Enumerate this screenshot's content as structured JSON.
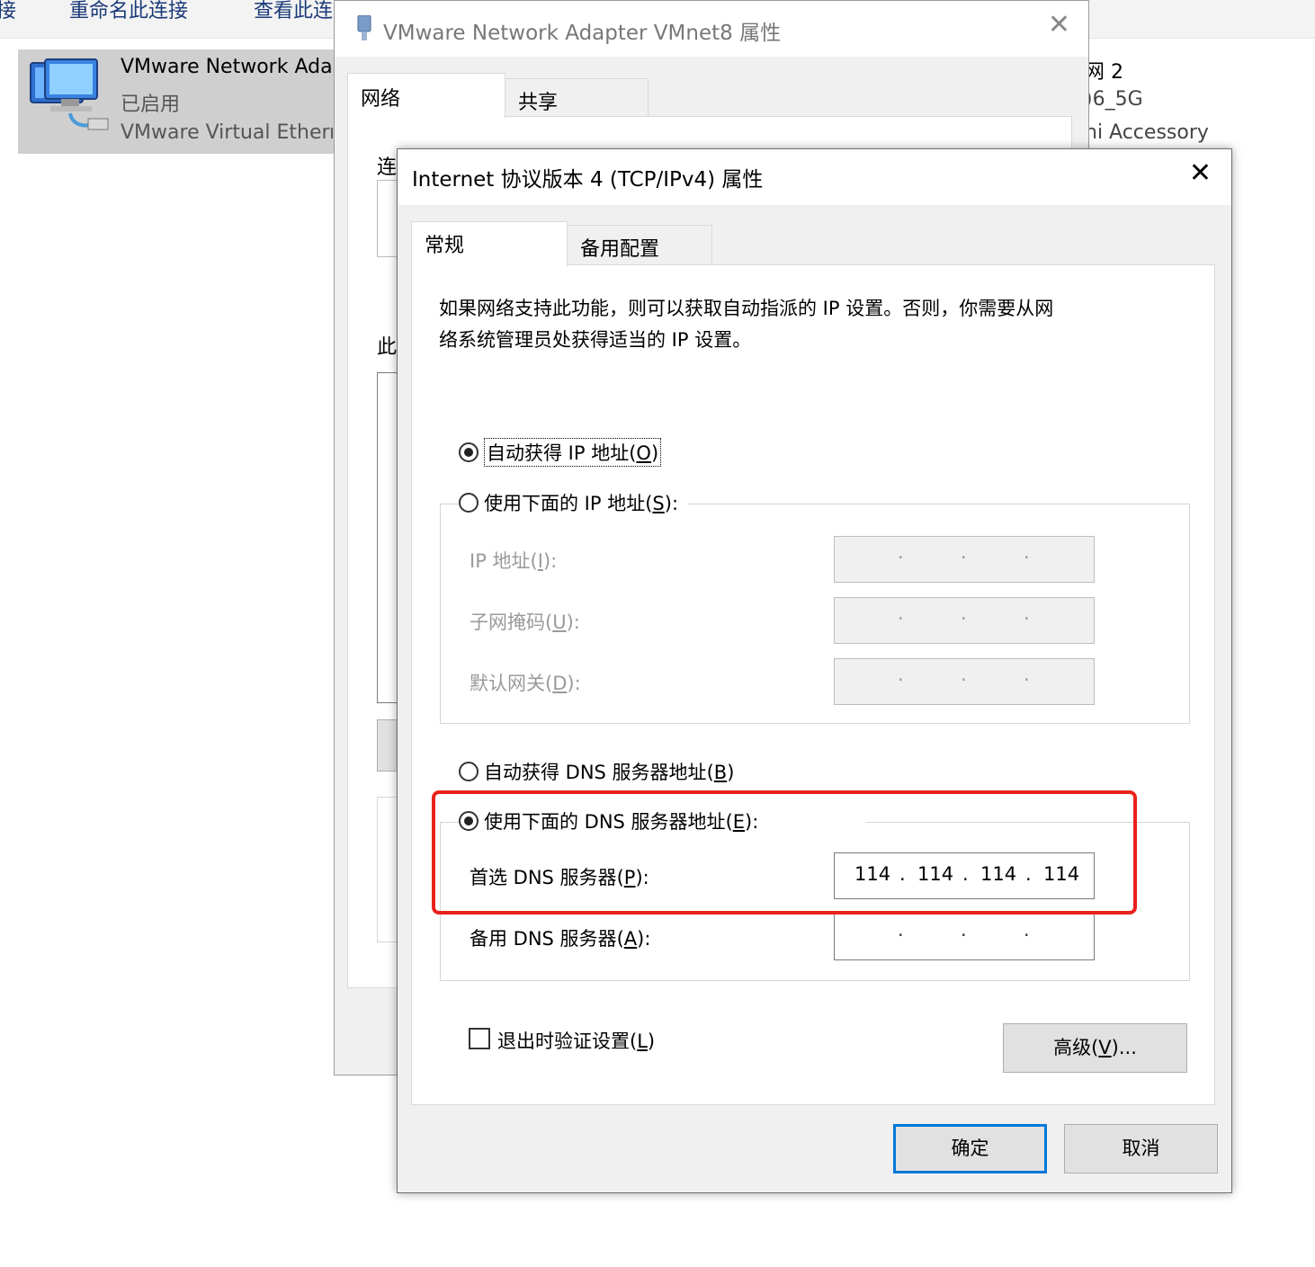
{
  "explorer": {
    "toolbar": {
      "item_cut": "接",
      "rename": "重命名此连接",
      "view_status": "查看此连"
    },
    "adapter": {
      "name": "VMware Network Ada",
      "status": "已启用",
      "driver": "VMware Virtual Ethern"
    },
    "right_adapter": {
      "line1": "网 2",
      "line2": ")6_5G",
      "line3": "ni Accessory"
    }
  },
  "back_dialog": {
    "title": "VMware Network Adapter VMnet8 属性",
    "close_glyph": "✕",
    "tabs": [
      "网络",
      "共享"
    ],
    "partial_label_connect": "连",
    "partial_label_this": "此"
  },
  "dialog": {
    "title": "Internet 协议版本 4 (TCP/IPv4) 属性",
    "close_glyph": "✕",
    "tabs": [
      "常规",
      "备用配置"
    ],
    "description_line1": "如果网络支持此功能，则可以获取自动指派的 IP 设置。否则，你需要从网",
    "description_line2": "络系统管理员处获得适当的 IP 设置。",
    "ip_auto": {
      "label": "自动获得 IP 地址",
      "key": "O",
      "checked": true
    },
    "ip_manual": {
      "label": "使用下面的 IP 地址",
      "key": "S",
      "suffix": ":",
      "checked": false
    },
    "ip_address": {
      "label": "IP 地址",
      "key": "I",
      "dots": [
        "·",
        "·",
        "·"
      ]
    },
    "subnet_mask": {
      "label": "子网掩码",
      "key": "U",
      "dots": [
        "·",
        "·",
        "·"
      ]
    },
    "gateway": {
      "label": "默认网关",
      "key": "D",
      "dots": [
        "·",
        "·",
        "·"
      ]
    },
    "dns_auto": {
      "label": "自动获得 DNS 服务器地址",
      "key": "B",
      "checked": false
    },
    "dns_manual": {
      "label": "使用下面的 DNS 服务器地址",
      "key": "E",
      "suffix": ":",
      "checked": true
    },
    "preferred_dns": {
      "label": "首选 DNS 服务器",
      "key": "P",
      "octets": [
        "114",
        "114",
        "114",
        "114"
      ],
      "sep": "."
    },
    "alternate_dns": {
      "label": "备用 DNS 服务器",
      "key": "A",
      "dots": [
        "·",
        "·",
        "·"
      ]
    },
    "validate_on_exit": {
      "label": "退出时验证设置",
      "key": "L",
      "checked": false
    },
    "advanced_button": {
      "label": "高级",
      "key": "V",
      "suffix": "..."
    },
    "ok_button": "确定",
    "cancel_button": "取消",
    "highlight_color": "#e8231a"
  }
}
